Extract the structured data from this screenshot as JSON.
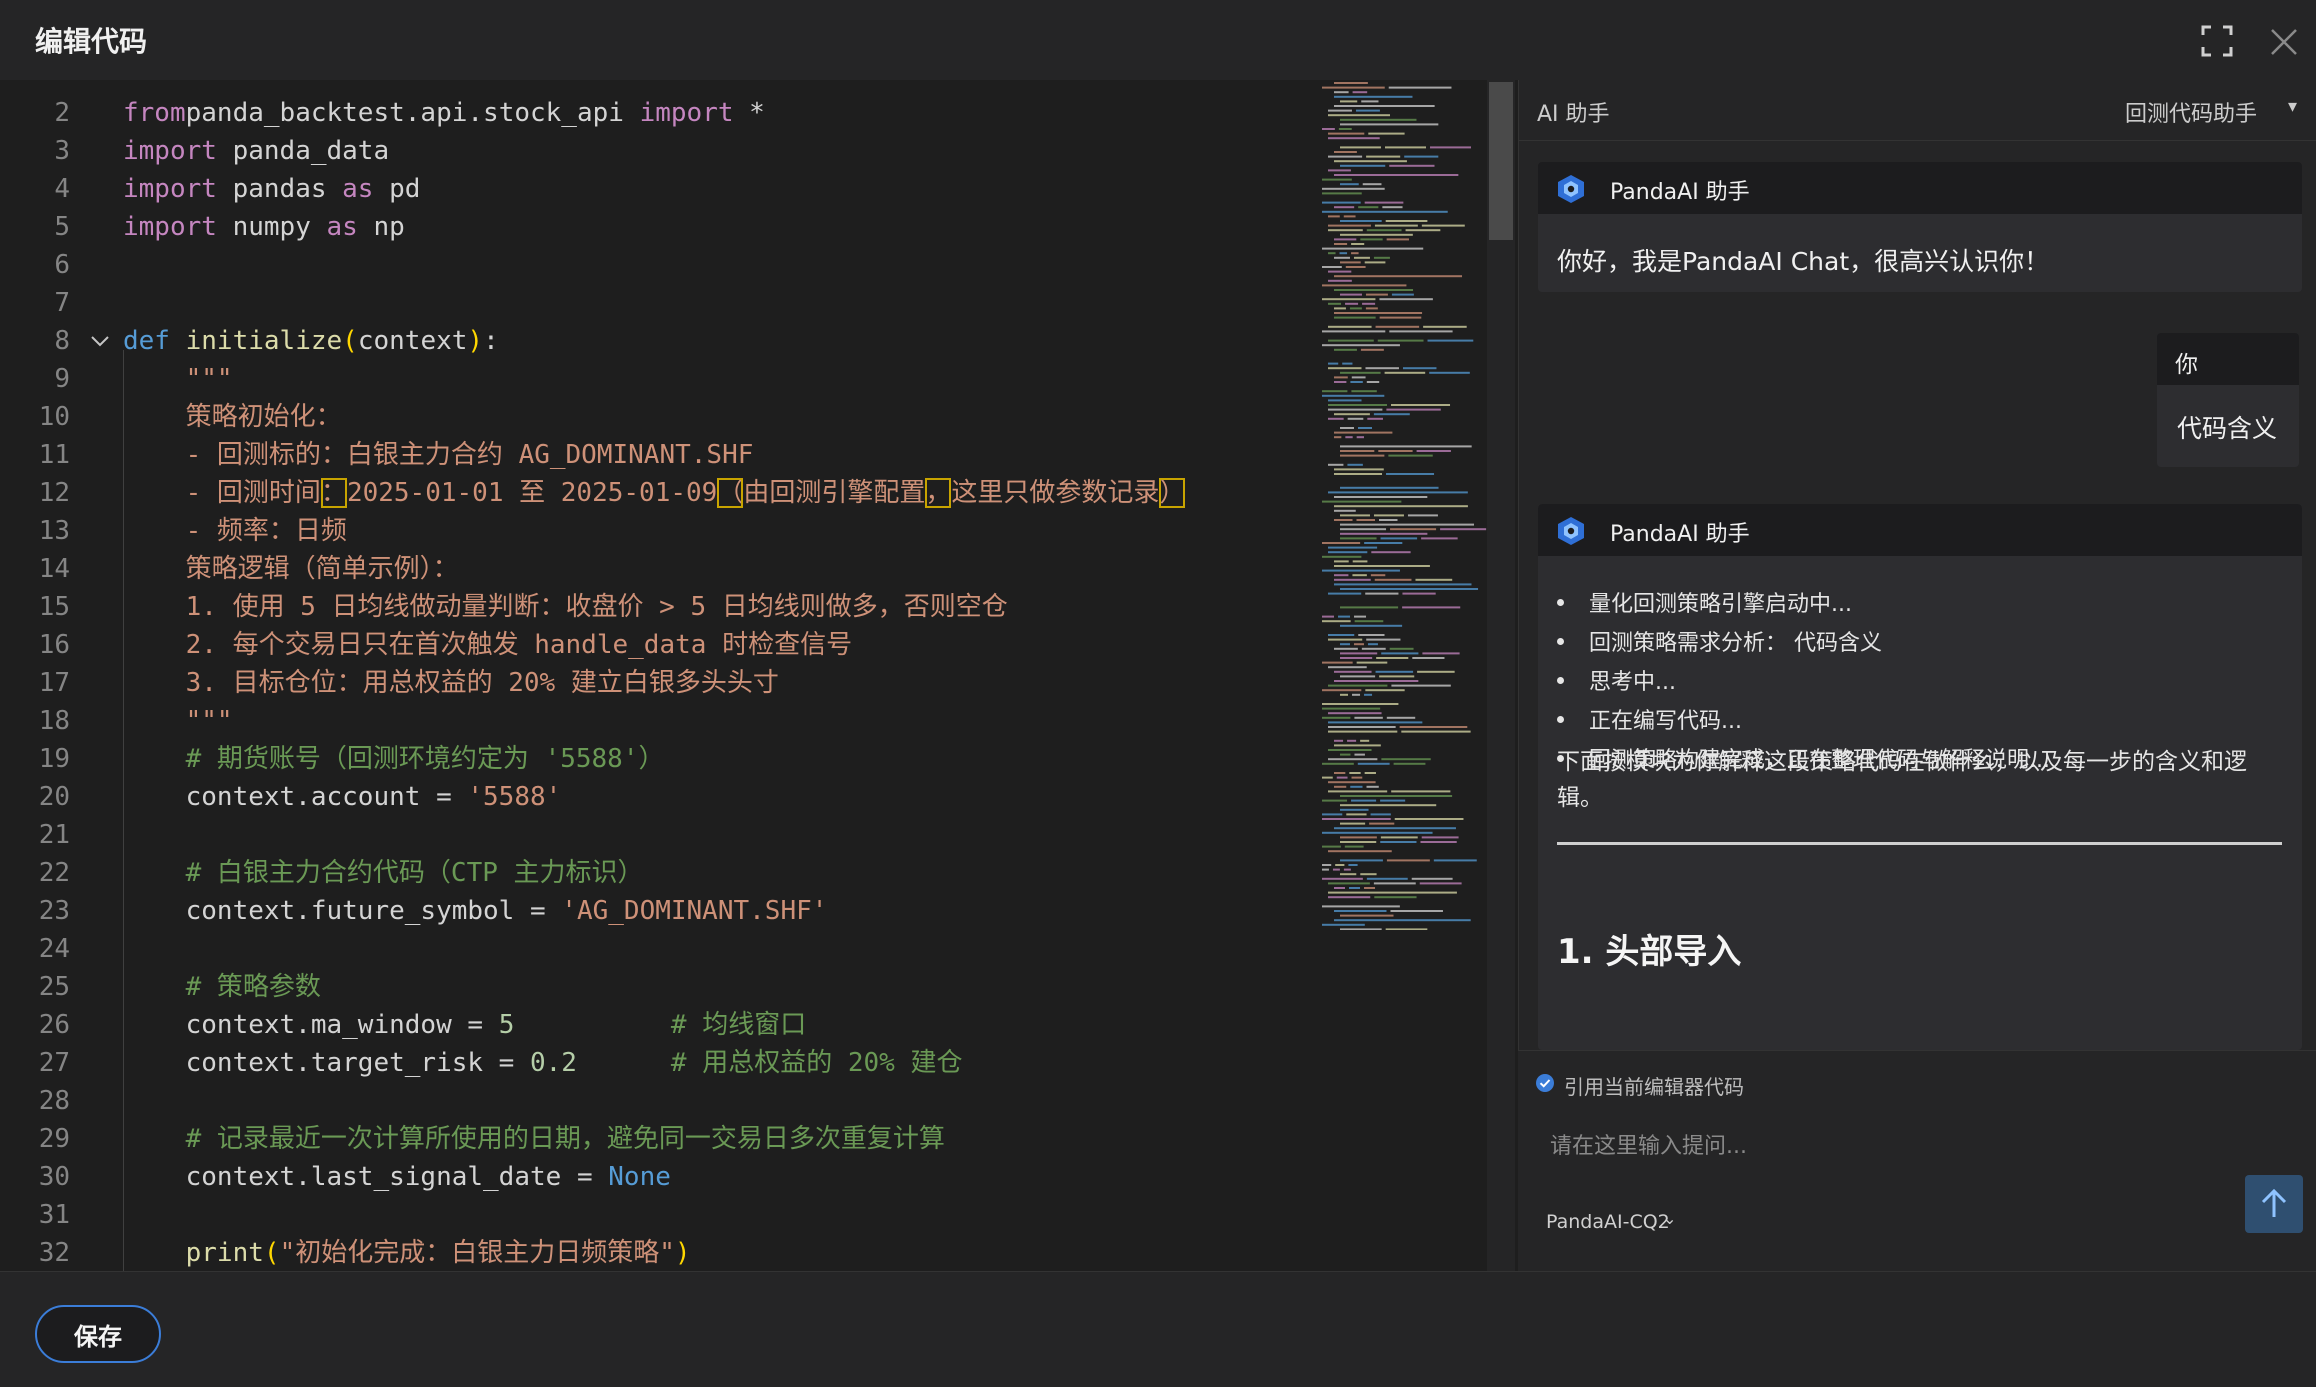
{
  "window": {
    "title": "编辑代码"
  },
  "editor": {
    "lines": [
      {
        "n": "2",
        "parts": [
          [
            "kw2",
            "from"
          ],
          [
            "",
            "panda_backtest.api.stock_api "
          ],
          [
            "kw2",
            "import"
          ],
          [
            "",
            " *"
          ]
        ]
      },
      {
        "n": "3",
        "parts": [
          [
            "kw2",
            "import"
          ],
          [
            "",
            " panda_data"
          ]
        ]
      },
      {
        "n": "4",
        "parts": [
          [
            "kw2",
            "import"
          ],
          [
            "",
            " pandas "
          ],
          [
            "kw2",
            "as"
          ],
          [
            "",
            " pd"
          ]
        ]
      },
      {
        "n": "5",
        "parts": [
          [
            "kw2",
            "import"
          ],
          [
            "",
            " numpy "
          ],
          [
            "kw2",
            "as"
          ],
          [
            "",
            " np"
          ]
        ]
      },
      {
        "n": "6",
        "parts": []
      },
      {
        "n": "7",
        "parts": []
      },
      {
        "n": "8",
        "fold": true,
        "parts": [
          [
            "kw",
            "def"
          ],
          [
            "",
            " "
          ],
          [
            "fn",
            "initialize"
          ],
          [
            "paren",
            "("
          ],
          [
            "",
            "context"
          ],
          [
            "paren",
            ")"
          ],
          [
            "",
            ":"
          ]
        ]
      },
      {
        "n": "9",
        "parts": [
          [
            "str",
            "    \"\"\""
          ]
        ]
      },
      {
        "n": "10",
        "parts": [
          [
            "str",
            "    策略初始化："
          ]
        ]
      },
      {
        "n": "11",
        "parts": [
          [
            "str",
            "    - 回测标的：白银主力合约 AG_DOMINANT.SHF"
          ]
        ]
      },
      {
        "n": "12",
        "parts": [
          [
            "str",
            "    - 回测时间"
          ],
          [
            "str hl",
            "："
          ],
          [
            "str",
            "2025-01-01 至 2025-01-09"
          ],
          [
            "str hl",
            "（"
          ],
          [
            "str",
            "由回测引擎配置"
          ],
          [
            "str hl",
            "，"
          ],
          [
            "str",
            "这里只做参数记录"
          ],
          [
            "str hl",
            "）"
          ]
        ]
      },
      {
        "n": "13",
        "parts": [
          [
            "str",
            "    - 频率：日频"
          ]
        ]
      },
      {
        "n": "14",
        "parts": [
          [
            "str",
            "    策略逻辑（简单示例）："
          ]
        ]
      },
      {
        "n": "15",
        "parts": [
          [
            "str",
            "    1. 使用 5 日均线做动量判断：收盘价 > 5 日均线则做多，否则空仓"
          ]
        ]
      },
      {
        "n": "16",
        "parts": [
          [
            "str",
            "    2. 每个交易日只在首次触发 handle_data 时检查信号"
          ]
        ]
      },
      {
        "n": "17",
        "parts": [
          [
            "str",
            "    3. 目标仓位：用总权益的 20% 建立白银多头头寸"
          ]
        ]
      },
      {
        "n": "18",
        "parts": [
          [
            "str",
            "    \"\"\""
          ]
        ]
      },
      {
        "n": "19",
        "parts": [
          [
            "cmt",
            "    # 期货账号（回测环境约定为 '5588'）"
          ]
        ]
      },
      {
        "n": "20",
        "parts": [
          [
            "",
            "    context.account = "
          ],
          [
            "str",
            "'5588'"
          ]
        ]
      },
      {
        "n": "21",
        "parts": []
      },
      {
        "n": "22",
        "parts": [
          [
            "cmt",
            "    # 白银主力合约代码（CTP 主力标识）"
          ]
        ]
      },
      {
        "n": "23",
        "parts": [
          [
            "",
            "    context.future_symbol = "
          ],
          [
            "str",
            "'AG_DOMINANT.SHF'"
          ]
        ]
      },
      {
        "n": "24",
        "parts": []
      },
      {
        "n": "25",
        "parts": [
          [
            "cmt",
            "    # 策略参数"
          ]
        ]
      },
      {
        "n": "26",
        "parts": [
          [
            "",
            "    context.ma_window = "
          ],
          [
            "num",
            "5"
          ],
          [
            "",
            "          "
          ],
          [
            "cmt",
            "# 均线窗口"
          ]
        ]
      },
      {
        "n": "27",
        "parts": [
          [
            "",
            "    context.target_risk = "
          ],
          [
            "num",
            "0.2"
          ],
          [
            "",
            "      "
          ],
          [
            "cmt",
            "# 用总权益的 20% 建仓"
          ]
        ]
      },
      {
        "n": "28",
        "parts": []
      },
      {
        "n": "29",
        "parts": [
          [
            "cmt",
            "    # 记录最近一次计算所使用的日期，避免同一交易日多次重复计算"
          ]
        ]
      },
      {
        "n": "30",
        "parts": [
          [
            "",
            "    context.last_signal_date = "
          ],
          [
            "kw",
            "None"
          ]
        ]
      },
      {
        "n": "31",
        "parts": []
      },
      {
        "n": "32",
        "parts": [
          [
            "",
            "    "
          ],
          [
            "fn",
            "print"
          ],
          [
            "paren",
            "("
          ],
          [
            "str",
            "\"初始化完成：白银主力日频策略\""
          ],
          [
            "paren",
            ")"
          ]
        ]
      }
    ]
  },
  "assistant": {
    "panel_title": "AI 助手",
    "mode_label": "回测代码助手",
    "bot_name": "PandaAI 助手",
    "greeting": "你好，我是PandaAI Chat，很高兴认识你！",
    "user_name": "你",
    "user_message": "代码含义",
    "steps": [
      "量化回测策略引擎启动中...",
      "回测策略需求分析： 代码含义",
      "思考中...",
      "正在编写代码...",
      "回测策略构建完成，正在整理代码与解释说明..."
    ],
    "explanation": "下面按模块为你解释这段策略代码在做什么，以及每一步的含义和逻辑。",
    "section_heading": "1. 头部导入",
    "include_code_label": "引用当前编辑器代码",
    "input_placeholder": "请在这里输入提问...",
    "model_label": "PandaAI-CQ2"
  },
  "footer": {
    "save_label": "保存"
  },
  "colors": {
    "accent": "#3b7dd8",
    "send_button": "#2f4f70"
  }
}
